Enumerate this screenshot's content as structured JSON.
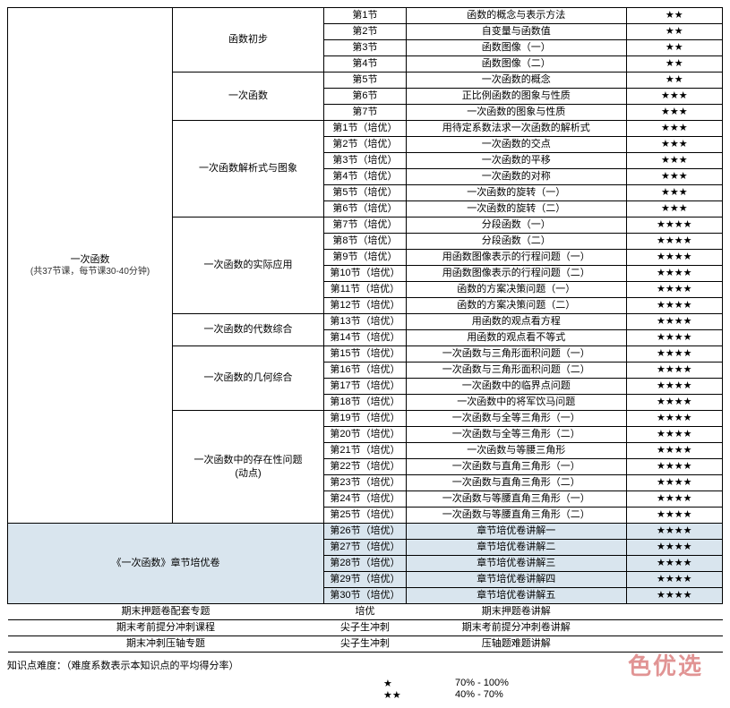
{
  "main_section": {
    "title": "一次函数",
    "subtitle": "(共37节课，每节课30-40分钟)"
  },
  "groups": [
    {
      "name": "函数初步",
      "rows": [
        {
          "lesson": "第1节",
          "title": "函数的概念与表示方法",
          "stars": "★★"
        },
        {
          "lesson": "第2节",
          "title": "自变量与函数值",
          "stars": "★★"
        },
        {
          "lesson": "第3节",
          "title": "函数图像（一）",
          "stars": "★★"
        },
        {
          "lesson": "第4节",
          "title": "函数图像（二）",
          "stars": "★★"
        }
      ]
    },
    {
      "name": "一次函数",
      "rows": [
        {
          "lesson": "第5节",
          "title": "一次函数的概念",
          "stars": "★★"
        },
        {
          "lesson": "第6节",
          "title": "正比例函数的图象与性质",
          "stars": "★★★"
        },
        {
          "lesson": "第7节",
          "title": "一次函数的图象与性质",
          "stars": "★★★"
        }
      ]
    },
    {
      "name": "一次函数解析式与图象",
      "rows": [
        {
          "lesson": "第1节（培优）",
          "title": "用待定系数法求一次函数的解析式",
          "stars": "★★★"
        },
        {
          "lesson": "第2节（培优）",
          "title": "一次函数的交点",
          "stars": "★★★"
        },
        {
          "lesson": "第3节（培优）",
          "title": "一次函数的平移",
          "stars": "★★★"
        },
        {
          "lesson": "第4节（培优）",
          "title": "一次函数的对称",
          "stars": "★★★"
        },
        {
          "lesson": "第5节（培优）",
          "title": "一次函数的旋转（一）",
          "stars": "★★★"
        },
        {
          "lesson": "第6节（培优）",
          "title": "一次函数的旋转（二）",
          "stars": "★★★"
        }
      ]
    },
    {
      "name": "一次函数的实际应用",
      "rows": [
        {
          "lesson": "第7节（培优）",
          "title": "分段函数（一）",
          "stars": "★★★★"
        },
        {
          "lesson": "第8节（培优）",
          "title": "分段函数（二）",
          "stars": "★★★★"
        },
        {
          "lesson": "第9节（培优）",
          "title": "用函数图像表示的行程问题（一）",
          "stars": "★★★★"
        },
        {
          "lesson": "第10节（培优）",
          "title": "用函数图像表示的行程问题（二）",
          "stars": "★★★★"
        },
        {
          "lesson": "第11节（培优）",
          "title": "函数的方案决策问题（一）",
          "stars": "★★★★"
        },
        {
          "lesson": "第12节（培优）",
          "title": "函数的方案决策问题（二）",
          "stars": "★★★★"
        }
      ]
    },
    {
      "name": "一次函数的代数综合",
      "rows": [
        {
          "lesson": "第13节（培优）",
          "title": "用函数的观点看方程",
          "stars": "★★★★"
        },
        {
          "lesson": "第14节（培优）",
          "title": "用函数的观点看不等式",
          "stars": "★★★★"
        }
      ]
    },
    {
      "name": "一次函数的几何综合",
      "rows": [
        {
          "lesson": "第15节（培优）",
          "title": "一次函数与三角形面积问题（一）",
          "stars": "★★★★"
        },
        {
          "lesson": "第16节（培优）",
          "title": "一次函数与三角形面积问题（二）",
          "stars": "★★★★"
        },
        {
          "lesson": "第17节（培优）",
          "title": "一次函数中的临界点问题",
          "stars": "★★★★"
        },
        {
          "lesson": "第18节（培优）",
          "title": "一次函数中的将军饮马问题",
          "stars": "★★★★"
        }
      ]
    },
    {
      "name": "一次函数中的存在性问题\n(动点)",
      "rows": [
        {
          "lesson": "第19节（培优）",
          "title": "一次函数与全等三角形（一）",
          "stars": "★★★★"
        },
        {
          "lesson": "第20节（培优）",
          "title": "一次函数与全等三角形（二）",
          "stars": "★★★★"
        },
        {
          "lesson": "第21节（培优）",
          "title": "一次函数与等腰三角形",
          "stars": "★★★★"
        },
        {
          "lesson": "第22节（培优）",
          "title": "一次函数与直角三角形（一）",
          "stars": "★★★★"
        },
        {
          "lesson": "第23节（培优）",
          "title": "一次函数与直角三角形（二）",
          "stars": "★★★★"
        },
        {
          "lesson": "第24节（培优）",
          "title": "一次函数与等腰直角三角形（一）",
          "stars": "★★★★"
        },
        {
          "lesson": "第25节（培优）",
          "title": "一次函数与等腰直角三角形（二）",
          "stars": "★★★★"
        }
      ]
    }
  ],
  "chapter_test": {
    "title": "《一次函数》章节培优卷",
    "rows": [
      {
        "lesson": "第26节（培优）",
        "title": "章节培优卷讲解一",
        "stars": "★★★★"
      },
      {
        "lesson": "第27节（培优）",
        "title": "章节培优卷讲解二",
        "stars": "★★★★"
      },
      {
        "lesson": "第28节（培优）",
        "title": "章节培优卷讲解三",
        "stars": "★★★★"
      },
      {
        "lesson": "第29节（培优）",
        "title": "章节培优卷讲解四",
        "stars": "★★★★"
      },
      {
        "lesson": "第30节（培优）",
        "title": "章节培优卷讲解五",
        "stars": "★★★★"
      }
    ]
  },
  "footer_rows": [
    {
      "c1": "期末押题卷配套专题",
      "c2": "培优",
      "c3": "期末押题卷讲解",
      "c4": ""
    },
    {
      "c1": "期末考前提分冲刺课程",
      "c2": "尖子生冲刺",
      "c3": "期末考前提分冲刺卷讲解",
      "c4": ""
    },
    {
      "c1": "期末冲刺压轴专题",
      "c2": "尖子生冲刺",
      "c3": "压轴题难题讲解",
      "c4": ""
    }
  ],
  "note": "知识点难度：（难度系数表示本知识点的平均得分率）",
  "legend": [
    {
      "star": "★",
      "range": "70% - 100%"
    },
    {
      "star": "★★",
      "range": "40% - 70%"
    }
  ],
  "watermark": "色优选"
}
